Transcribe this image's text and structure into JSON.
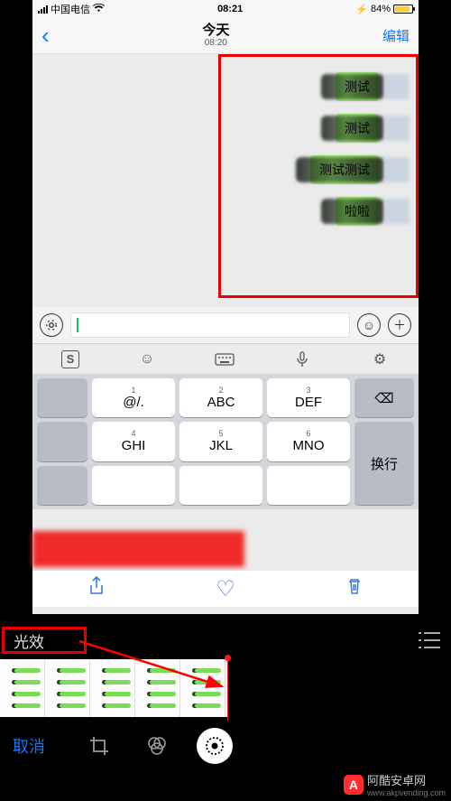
{
  "status": {
    "carrier": "中国电信",
    "time": "08:21",
    "battery_pct": "84%",
    "battery_icon": "⚡"
  },
  "nav": {
    "back_glyph": "‹",
    "title": "今天",
    "subtitle": "08:20",
    "edit": "编辑"
  },
  "chat": {
    "messages": [
      {
        "text": "测试"
      },
      {
        "text": "测试"
      },
      {
        "text": "测试测试"
      },
      {
        "text": "啦啦"
      }
    ]
  },
  "inputbar": {
    "voice_glyph": "⦾",
    "emoji_glyph": "☺",
    "plus_glyph": "＋"
  },
  "ktop": {
    "sogou": "S",
    "emoji": "☺",
    "keyboard": "⌨",
    "mic": "♪",
    "gear": "⚙"
  },
  "keys": {
    "r1": [
      "",
      "@/.",
      "ABC",
      "DEF",
      "⌫"
    ],
    "r1n": [
      "",
      "1",
      "2",
      "3",
      ""
    ],
    "r2": [
      "",
      "GHI",
      "JKL",
      "MNO",
      "换行"
    ],
    "r2n": [
      "",
      "4",
      "5",
      "6",
      ""
    ]
  },
  "sharerow": {
    "share": "⇧",
    "heart": "♡",
    "trash": "🗑"
  },
  "fx": {
    "label": "光效"
  },
  "bottombar": {
    "cancel": "取消"
  },
  "watermark": {
    "logo_text": "A",
    "text": "阿酷安卓网",
    "url": "www.akpvending.com"
  }
}
